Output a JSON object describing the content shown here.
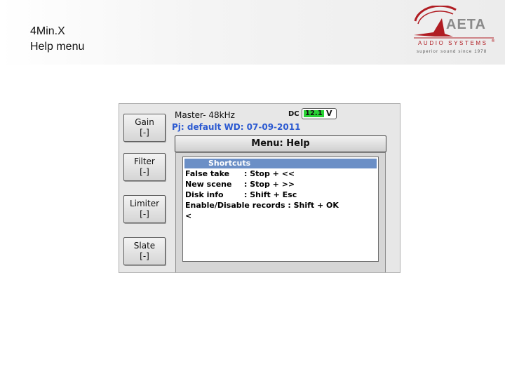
{
  "slide": {
    "title_line1": "4Min.X",
    "title_line2": "Help menu"
  },
  "logo": {
    "brand": "AETA",
    "subtitle": "AUDIO SYSTEMS",
    "registered": "®",
    "tagline": "superior sound since 1978",
    "accent_color": "#b01c22"
  },
  "device": {
    "side_buttons": [
      {
        "label": "Gain",
        "value": "[-]"
      },
      {
        "label": "Filter",
        "value": "[-]"
      },
      {
        "label": "Limiter",
        "value": "[-]"
      },
      {
        "label": "Slate",
        "value": "[-]"
      }
    ],
    "status": {
      "master": "Master- 48kHz",
      "project": "Pj: default  WD: 07-09-2011",
      "dc_label": "DC",
      "battery_value": "12.1",
      "battery_unit": "V",
      "battery_color": "#27d234",
      "project_color": "#2c5ad1"
    },
    "menu": {
      "title": "Menu: Help",
      "list_title": "Shortcuts",
      "list_title_color": "#6b8fc6",
      "items": [
        {
          "key": "False take",
          "value": ": Stop + <<"
        },
        {
          "key": "New scene",
          "value": ": Stop + >>"
        },
        {
          "key": "Disk info",
          "value": ": Shift + Esc"
        },
        {
          "key": "Enable/Disable records",
          "value": " : Shift + OK"
        },
        {
          "key": "<",
          "value": ""
        }
      ]
    }
  }
}
